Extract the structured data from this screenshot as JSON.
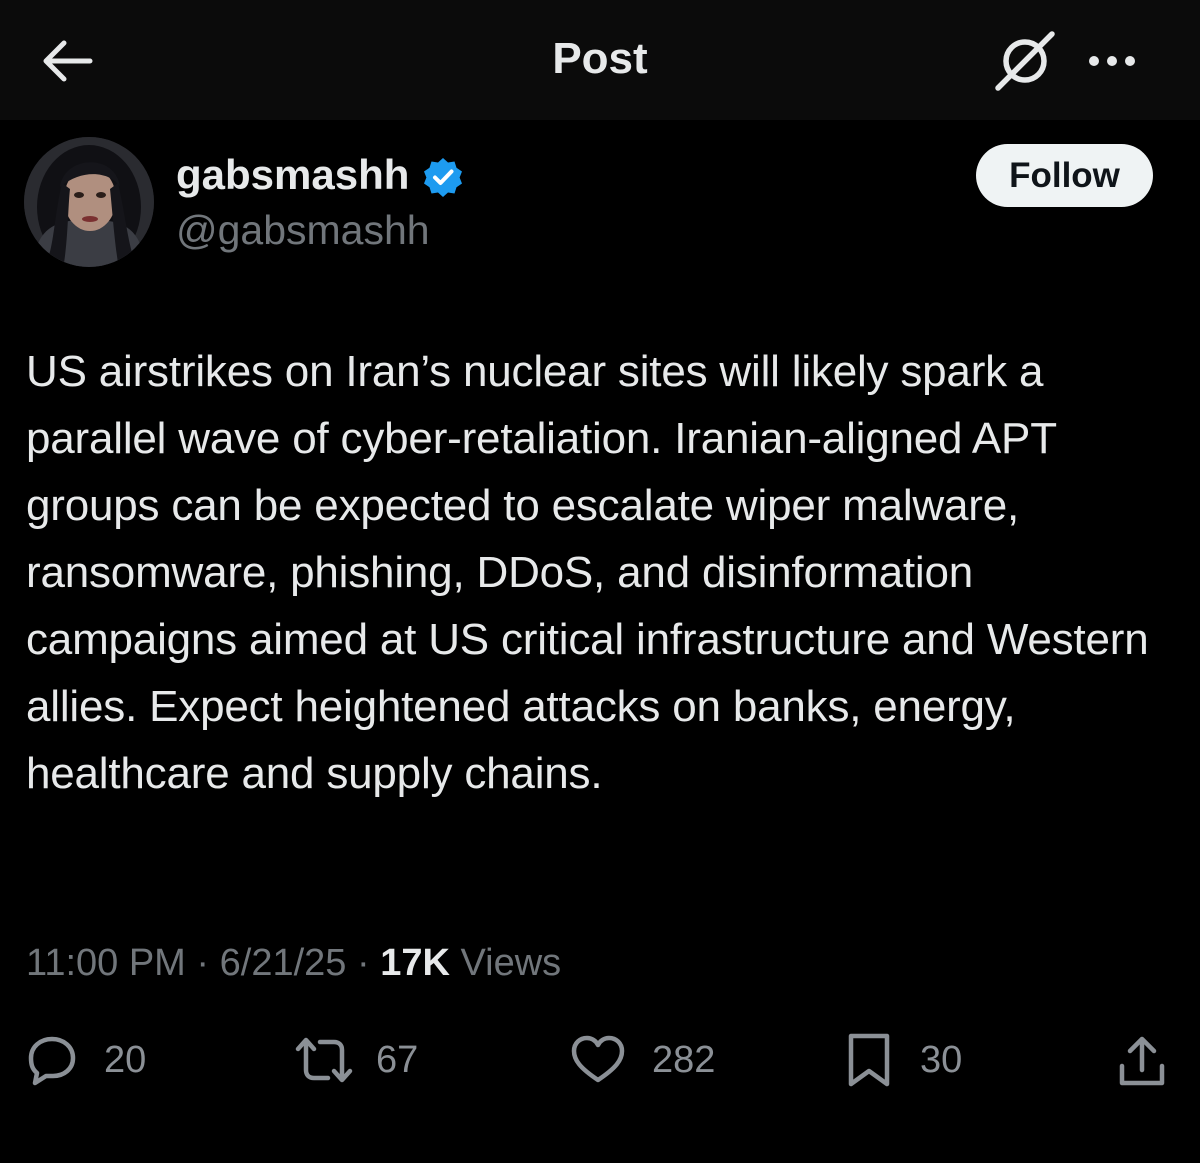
{
  "header": {
    "title": "Post",
    "back_icon": "arrow-left-icon",
    "grok_icon": "grok-icon",
    "more_icon": "more-horizontal-icon"
  },
  "author": {
    "display_name": "gabsmashh",
    "handle": "@gabsmashh",
    "verified": true,
    "verified_color": "#1d9bf0"
  },
  "follow_button": {
    "label": "Follow"
  },
  "post": {
    "text": "US airstrikes on Iran’s nuclear sites will likely spark a parallel wave of cyber-retaliation. Iranian-aligned APT groups can be expected to escalate wiper malware, ransomware, phishing, DDoS, and disinformation campaigns aimed at US critical infrastructure and Western allies. Expect heightened attacks on banks, energy, healthcare and supply chains.",
    "time": "11:00 PM",
    "date": "6/21/25",
    "separator": "·",
    "views_count": "17K",
    "views_label": "Views"
  },
  "actions": {
    "replies": "20",
    "reposts": "67",
    "likes": "282",
    "bookmarks": "30"
  }
}
